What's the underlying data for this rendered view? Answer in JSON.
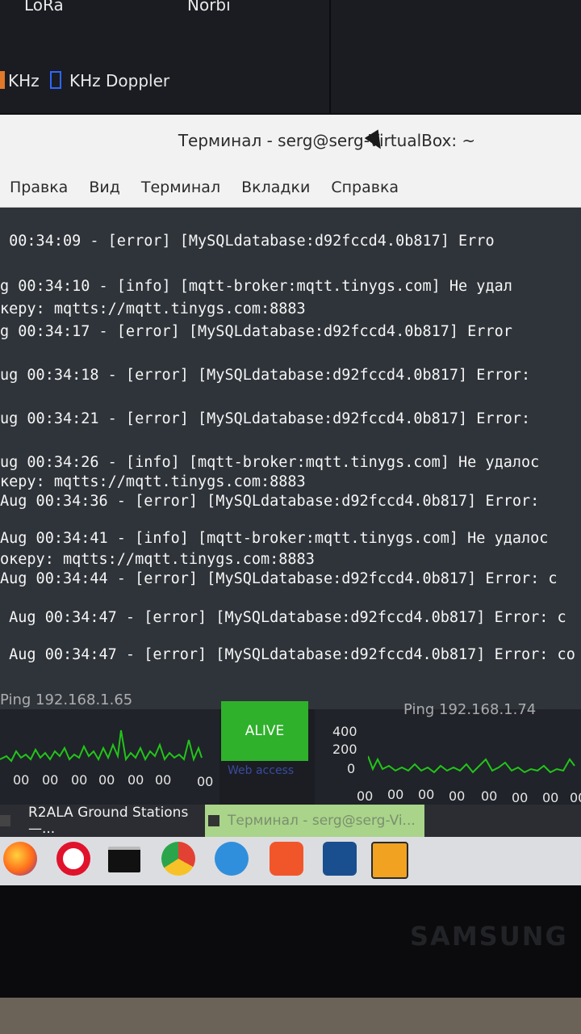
{
  "top": {
    "lora_label": "LoRa",
    "norbi_label": "Norbi",
    "khz_label": "KHz",
    "khz_doppler_label": "KHz Doppler"
  },
  "terminal": {
    "title": "Терминал - serg@serg-VirtualBox: ~",
    "menu": [
      "Правка",
      "Вид",
      "Терминал",
      "Вкладки",
      "Справка"
    ],
    "lines": [
      " 00:34:09 - [error] [MySQLdatabase:d92fccd4.0b817] Erro",
      "g 00:34:10 - [info] [mqtt-broker:mqtt.tinygs.com] Не удал",
      "керу: mqtts://mqtt.tinygs.com:8883",
      "g 00:34:17 - [error] [MySQLdatabase:d92fccd4.0b817] Error",
      "ug 00:34:18 - [error] [MySQLdatabase:d92fccd4.0b817] Error:",
      "ug 00:34:21 - [error] [MySQLdatabase:d92fccd4.0b817] Error:",
      "ug 00:34:26 - [info] [mqtt-broker:mqtt.tinygs.com] Не удалос",
      "керу: mqtts://mqtt.tinygs.com:8883",
      "Aug 00:34:36 - [error] [MySQLdatabase:d92fccd4.0b817] Error:",
      "Aug 00:34:41 - [info] [mqtt-broker:mqtt.tinygs.com] Не удалос",
      "океру: mqtts://mqtt.tinygs.com:8883",
      "Aug 00:34:44 - [error] [MySQLdatabase:d92fccd4.0b817] Error: с",
      " Aug 00:34:47 - [error] [MySQLdatabase:d92fccd4.0b817] Error: с",
      " Aug 00:34:47 - [error] [MySQLdatabase:d92fccd4.0b817] Error: со"
    ]
  },
  "dashboard": {
    "ping_left_title": "Ping 192.168.1.65",
    "ping_right_title": "Ping 192.168.1.74",
    "alive_label": "ALIVE",
    "web_label": "Web access",
    "left_ticks": [
      "00",
      "00",
      "00",
      "00",
      "00",
      "00",
      "00"
    ],
    "right_ticks": [
      "00",
      "00",
      "00",
      "00",
      "00",
      "00",
      "00",
      "00"
    ],
    "y_axis": [
      "400",
      "200",
      "0"
    ],
    "line_color": "#22c41a"
  },
  "taskbar": {
    "item_1": "R2ALA Ground Stations —...",
    "item_2": "Терминал - serg@serg-Vi...",
    "icons": [
      "firefox-icon",
      "opera-icon",
      "cmd-icon",
      "chrome-icon",
      "ie-icon",
      "brave-icon",
      "virtualbox-icon",
      "matlab-icon"
    ]
  },
  "monitor": {
    "brand": "SAMSUNG"
  }
}
